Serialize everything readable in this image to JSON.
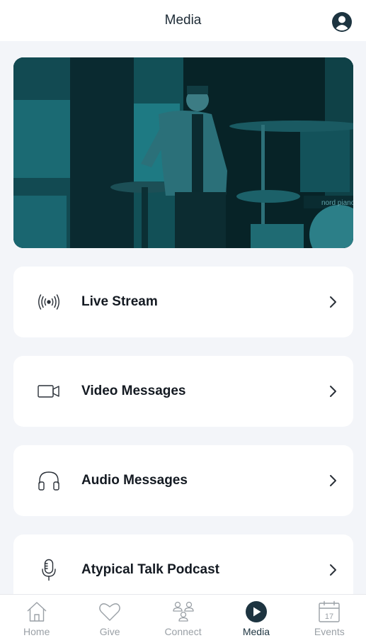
{
  "header": {
    "title": "Media",
    "profile_icon": "profile-icon"
  },
  "hero": {
    "tint_color": "#0e3a40",
    "overlay_text": "nord piano"
  },
  "menu": [
    {
      "label": "Live Stream",
      "icon": "broadcast-icon"
    },
    {
      "label": "Video Messages",
      "icon": "video-camera-icon"
    },
    {
      "label": "Audio Messages",
      "icon": "headphones-icon"
    },
    {
      "label": "Atypical Talk Podcast",
      "icon": "microphone-icon"
    }
  ],
  "tabs": [
    {
      "label": "Home",
      "icon": "home-icon",
      "active": false
    },
    {
      "label": "Give",
      "icon": "heart-icon",
      "active": false
    },
    {
      "label": "Connect",
      "icon": "people-icon",
      "active": false
    },
    {
      "label": "Media",
      "icon": "play-icon",
      "active": true
    },
    {
      "label": "Events",
      "icon": "calendar-icon",
      "active": false,
      "calendar_day": "17"
    }
  ],
  "colors": {
    "accent": "#1d3440",
    "inactive": "#9aa0a6",
    "background": "#f3f5f9"
  }
}
